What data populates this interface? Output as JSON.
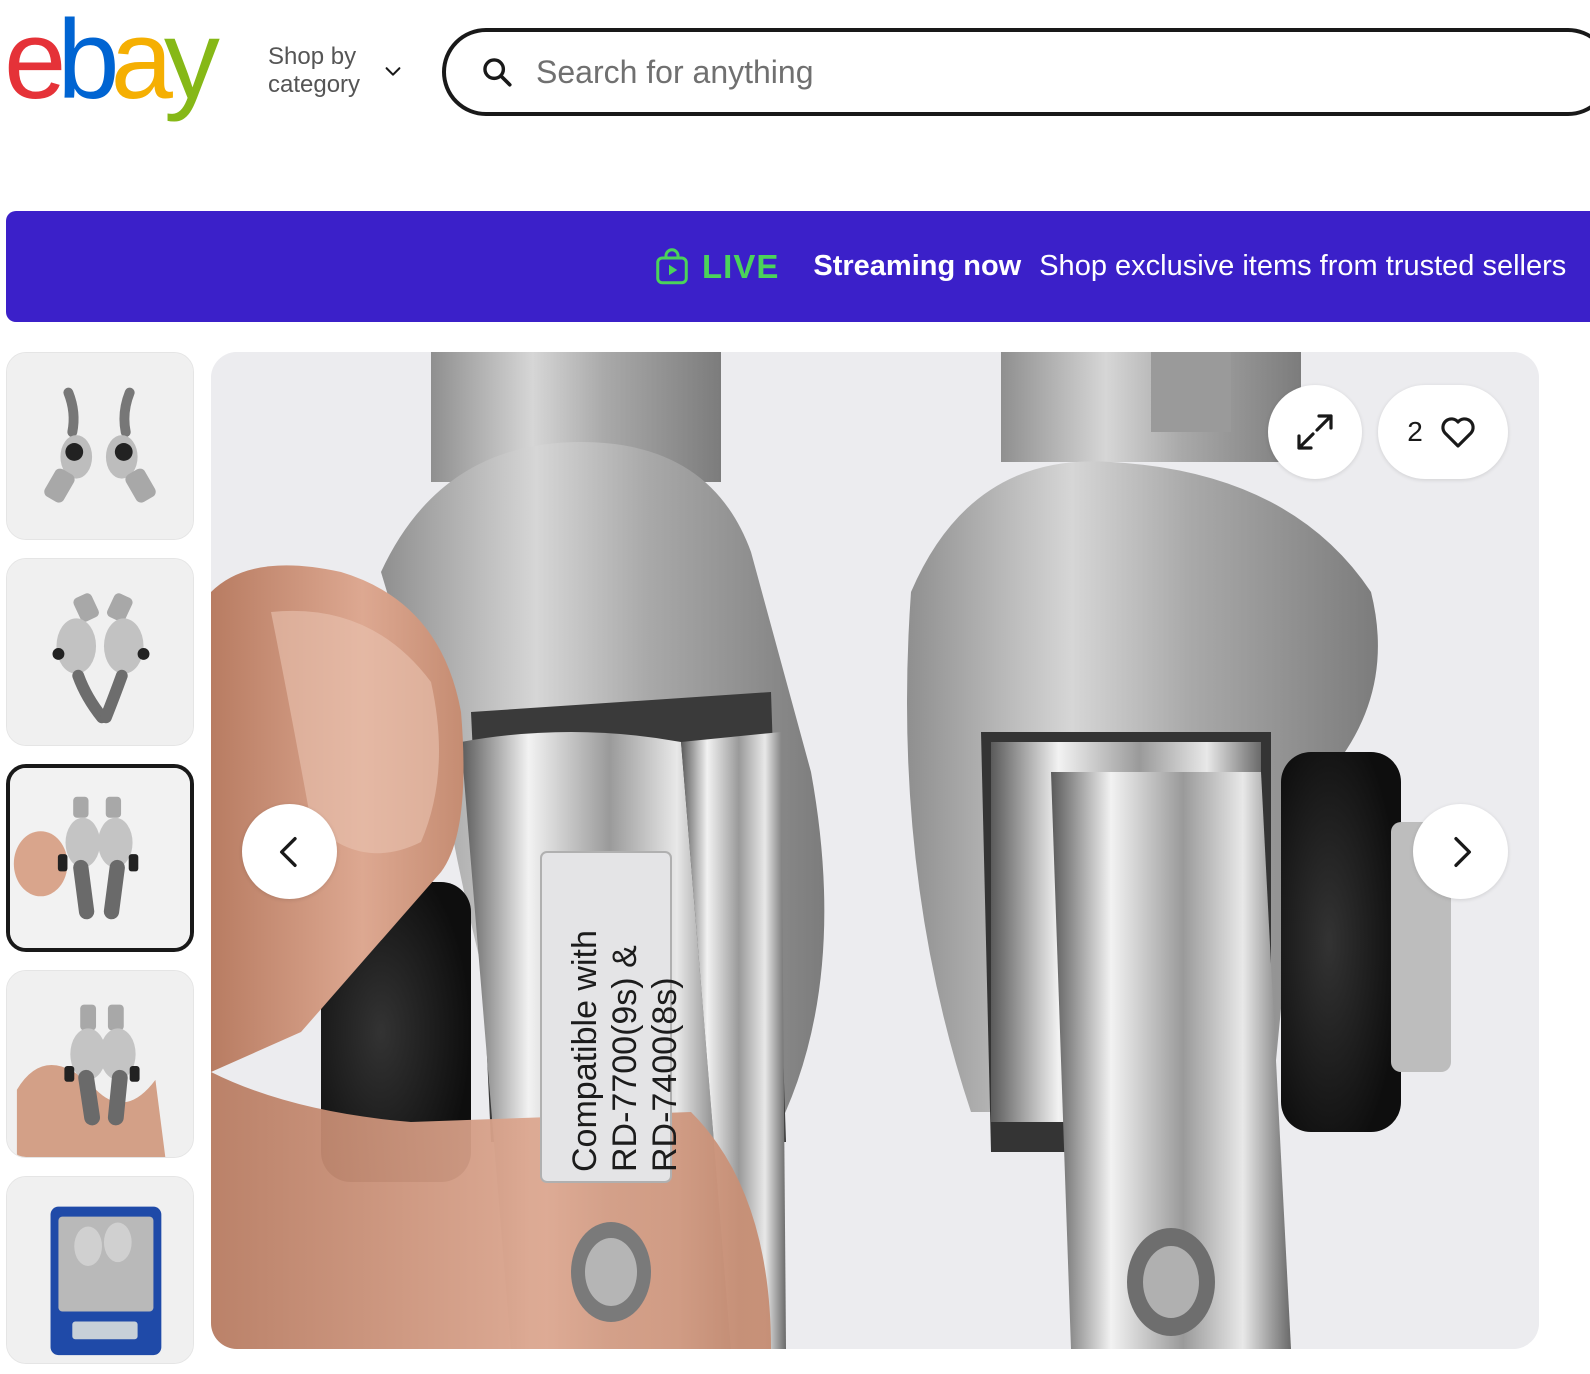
{
  "header": {
    "logo": {
      "letters": [
        "e",
        "b",
        "a",
        "y"
      ],
      "colors": [
        "#e53238",
        "#0064d2",
        "#f5af02",
        "#86b817"
      ]
    },
    "shop_by_category": "Shop by category",
    "search": {
      "placeholder": "Search for anything",
      "value": ""
    }
  },
  "live_banner": {
    "live_label": "LIVE",
    "streaming_label": "Streaming now",
    "text": "Shop exclusive items from trusted sellers",
    "background": "#3b20c9",
    "live_color": "#4bd35a"
  },
  "gallery": {
    "thumbnails": [
      {
        "alt": "shifters-pair-top-view",
        "selected": false
      },
      {
        "alt": "shifters-pair-bottom-view",
        "selected": false
      },
      {
        "alt": "shifters-in-hand",
        "selected": true
      },
      {
        "alt": "shifters-held-palm",
        "selected": false
      },
      {
        "alt": "shifters-on-scale",
        "selected": false
      }
    ],
    "main_image": {
      "label_text": [
        "Compatible with",
        "RD-7700(9s) &",
        "RD-7400(8s)"
      ]
    },
    "watch_count": "2"
  },
  "icons": {
    "search": "search-icon",
    "chevron": "chevron-down-icon",
    "live": "shopping-bag-play-icon",
    "expand": "expand-icon",
    "heart": "heart-icon",
    "prev": "chevron-left-icon",
    "next": "chevron-right-icon"
  }
}
